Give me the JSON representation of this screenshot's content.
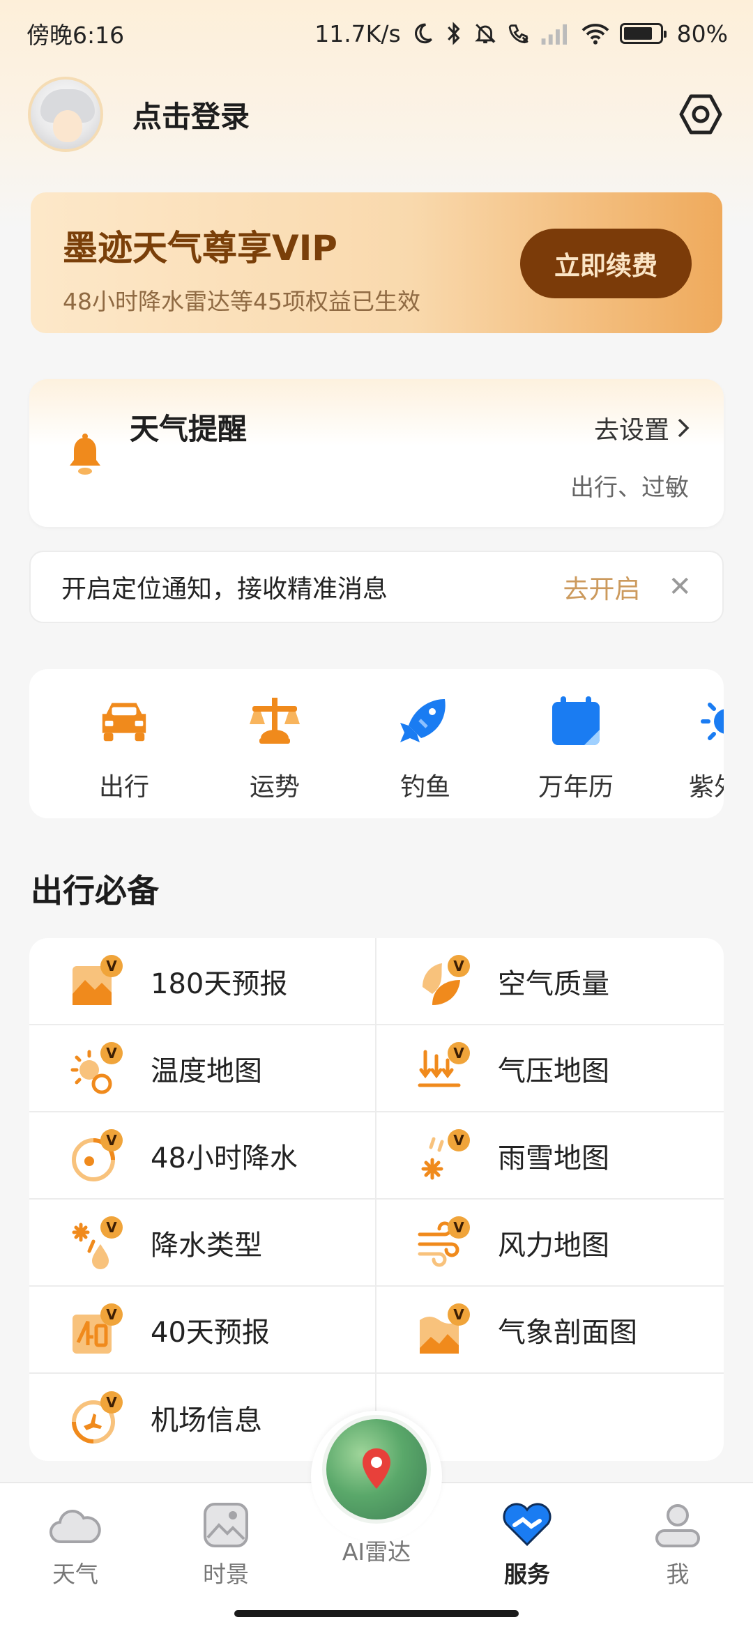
{
  "status_bar": {
    "time": "傍晚6:16",
    "network_speed": "11.7K/s",
    "battery": "80%",
    "battery_level": 0.8
  },
  "header": {
    "login_text": "点击登录"
  },
  "vip": {
    "title": "墨迹天气尊享VIP",
    "subtitle": "48小时降水雷达等45项权益已生效",
    "button": "立即续费"
  },
  "reminder": {
    "title": "天气提醒",
    "link": "去设置",
    "tags": "出行、过敏"
  },
  "location_notice": {
    "text": "开启定位通知，接收精准消息",
    "action": "去开启",
    "close": "✕"
  },
  "shortcuts": [
    {
      "label": "出行",
      "icon": "car-icon"
    },
    {
      "label": "运势",
      "icon": "balance-icon"
    },
    {
      "label": "钓鱼",
      "icon": "fish-icon"
    },
    {
      "label": "万年历",
      "icon": "calendar-icon"
    },
    {
      "label": "紫外线",
      "icon": "sun-icon"
    }
  ],
  "section": {
    "title": "出行必备"
  },
  "grid": [
    {
      "label": "180天预报",
      "icon": "forecast-180-icon"
    },
    {
      "label": "空气质量",
      "icon": "leaf-icon"
    },
    {
      "label": "温度地图",
      "icon": "temperature-icon"
    },
    {
      "label": "气压地图",
      "icon": "pressure-icon"
    },
    {
      "label": "48小时降水",
      "icon": "precipitation-icon"
    },
    {
      "label": "雨雪地图",
      "icon": "rain-snow-icon"
    },
    {
      "label": "降水类型",
      "icon": "precip-type-icon"
    },
    {
      "label": "风力地图",
      "icon": "wind-icon"
    },
    {
      "label": "40天预报",
      "icon": "forecast-40-icon"
    },
    {
      "label": "气象剖面图",
      "icon": "profile-icon"
    },
    {
      "label": "机场信息",
      "icon": "airport-icon"
    }
  ],
  "grid_badge": "V",
  "nav": {
    "weather": "天气",
    "scenery": "时景",
    "radar": "AI雷达",
    "service": "服务",
    "me": "我"
  },
  "colors": {
    "accent_orange": "#f08a1c",
    "vip_brown": "#7b3b09",
    "link_gold": "#cc9a5d",
    "blue": "#1a7cf2"
  }
}
